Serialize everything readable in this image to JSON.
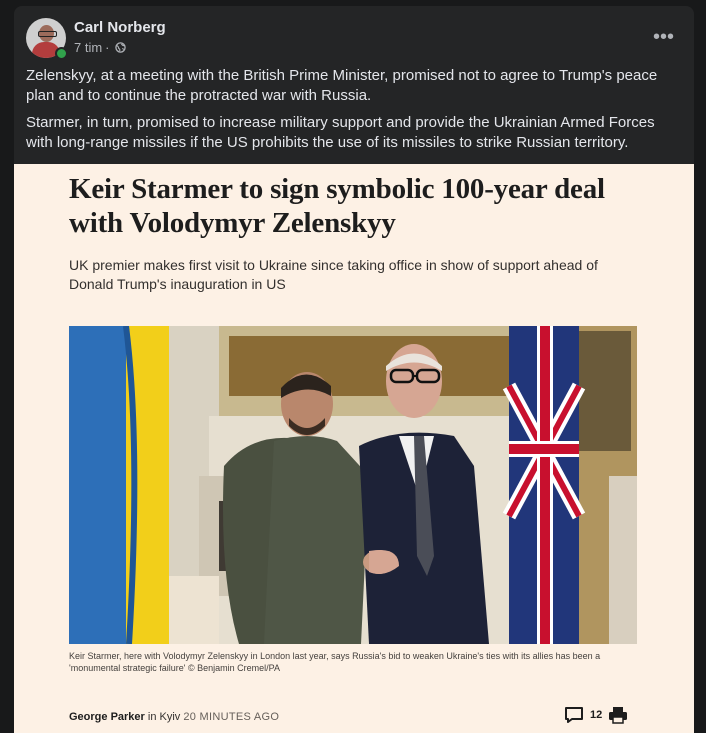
{
  "post": {
    "author": "Carl Norberg",
    "time": "7 tim",
    "separator": "·",
    "body": [
      "Zelenskyy, at a meeting with the British Prime Minister, promised not to agree to Trump's peace plan and to continue the protracted war with Russia.",
      "Starmer, in turn, promised to increase military support and provide the Ukrainian Armed Forces with long-range missiles if the US prohibits the use of its missiles to strike Russian territory."
    ]
  },
  "article": {
    "headline": "Keir Starmer to sign symbolic 100-year deal with Volodymyr Zelenskyy",
    "standfirst": "UK premier makes first visit to Ukraine since taking office in show of support ahead of Donald Trump's inauguration in US",
    "caption": "Keir Starmer, here with Volodymyr Zelenskyy in London last year, says Russia's bid to weaken Ukraine's ties with its allies has been a 'monumental strategic failure' © Benjamin Cremel/PA",
    "byline_author": "George Parker",
    "byline_in": "in",
    "byline_place": "Kyiv",
    "byline_time": "20 MINUTES AGO",
    "comment_count": "12"
  },
  "icons": {
    "globe": "globe-icon",
    "more": "more-options-icon",
    "comment": "comment-icon",
    "print": "print-icon"
  },
  "colors": {
    "background": "#18191a",
    "card": "#242526",
    "text": "#e4e6eb",
    "muted": "#b0b3b8",
    "online": "#31a24c",
    "article_bg": "#fdf1e5"
  }
}
